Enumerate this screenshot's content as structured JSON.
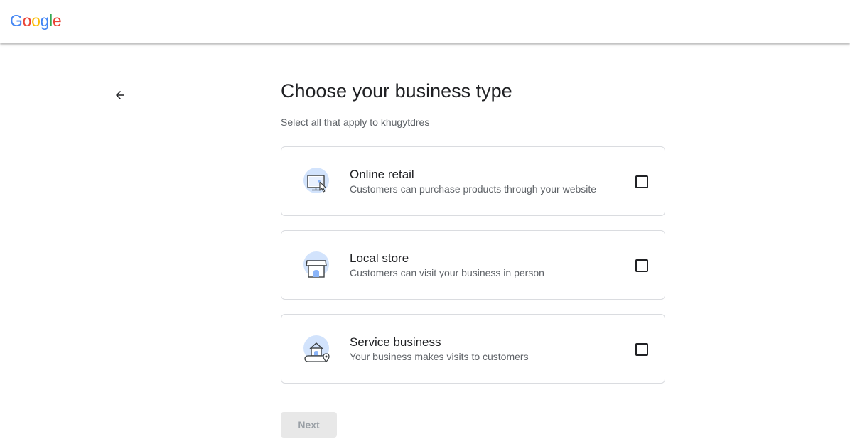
{
  "header": {
    "logo_letters": [
      {
        "char": "G",
        "color": "#4285F4"
      },
      {
        "char": "o",
        "color": "#EA4335"
      },
      {
        "char": "o",
        "color": "#FBBC05"
      },
      {
        "char": "g",
        "color": "#4285F4"
      },
      {
        "char": "l",
        "color": "#34A853"
      },
      {
        "char": "e",
        "color": "#EA4335"
      }
    ]
  },
  "nav": {
    "back_icon": "arrow-left-icon"
  },
  "page": {
    "title": "Choose your business type",
    "subtitle": "Select all that apply to khugytdres"
  },
  "options": [
    {
      "title": "Online retail",
      "description": "Customers can purchase products through your website",
      "icon": "monitor-cursor-icon",
      "checked": false
    },
    {
      "title": "Local store",
      "description": "Customers can visit your business in person",
      "icon": "storefront-icon",
      "checked": false
    },
    {
      "title": "Service business",
      "description": "Your business makes visits to customers",
      "icon": "house-map-pin-icon",
      "checked": false
    }
  ],
  "actions": {
    "next_label": "Next",
    "next_enabled": false
  },
  "colors": {
    "icon_circle": "#d2e3fc",
    "icon_accent": "#8ab4f8",
    "text_primary": "#202124",
    "text_secondary": "#5f6368",
    "disabled_button_bg": "#e8e8e8",
    "disabled_button_text": "#9aa0a6"
  }
}
